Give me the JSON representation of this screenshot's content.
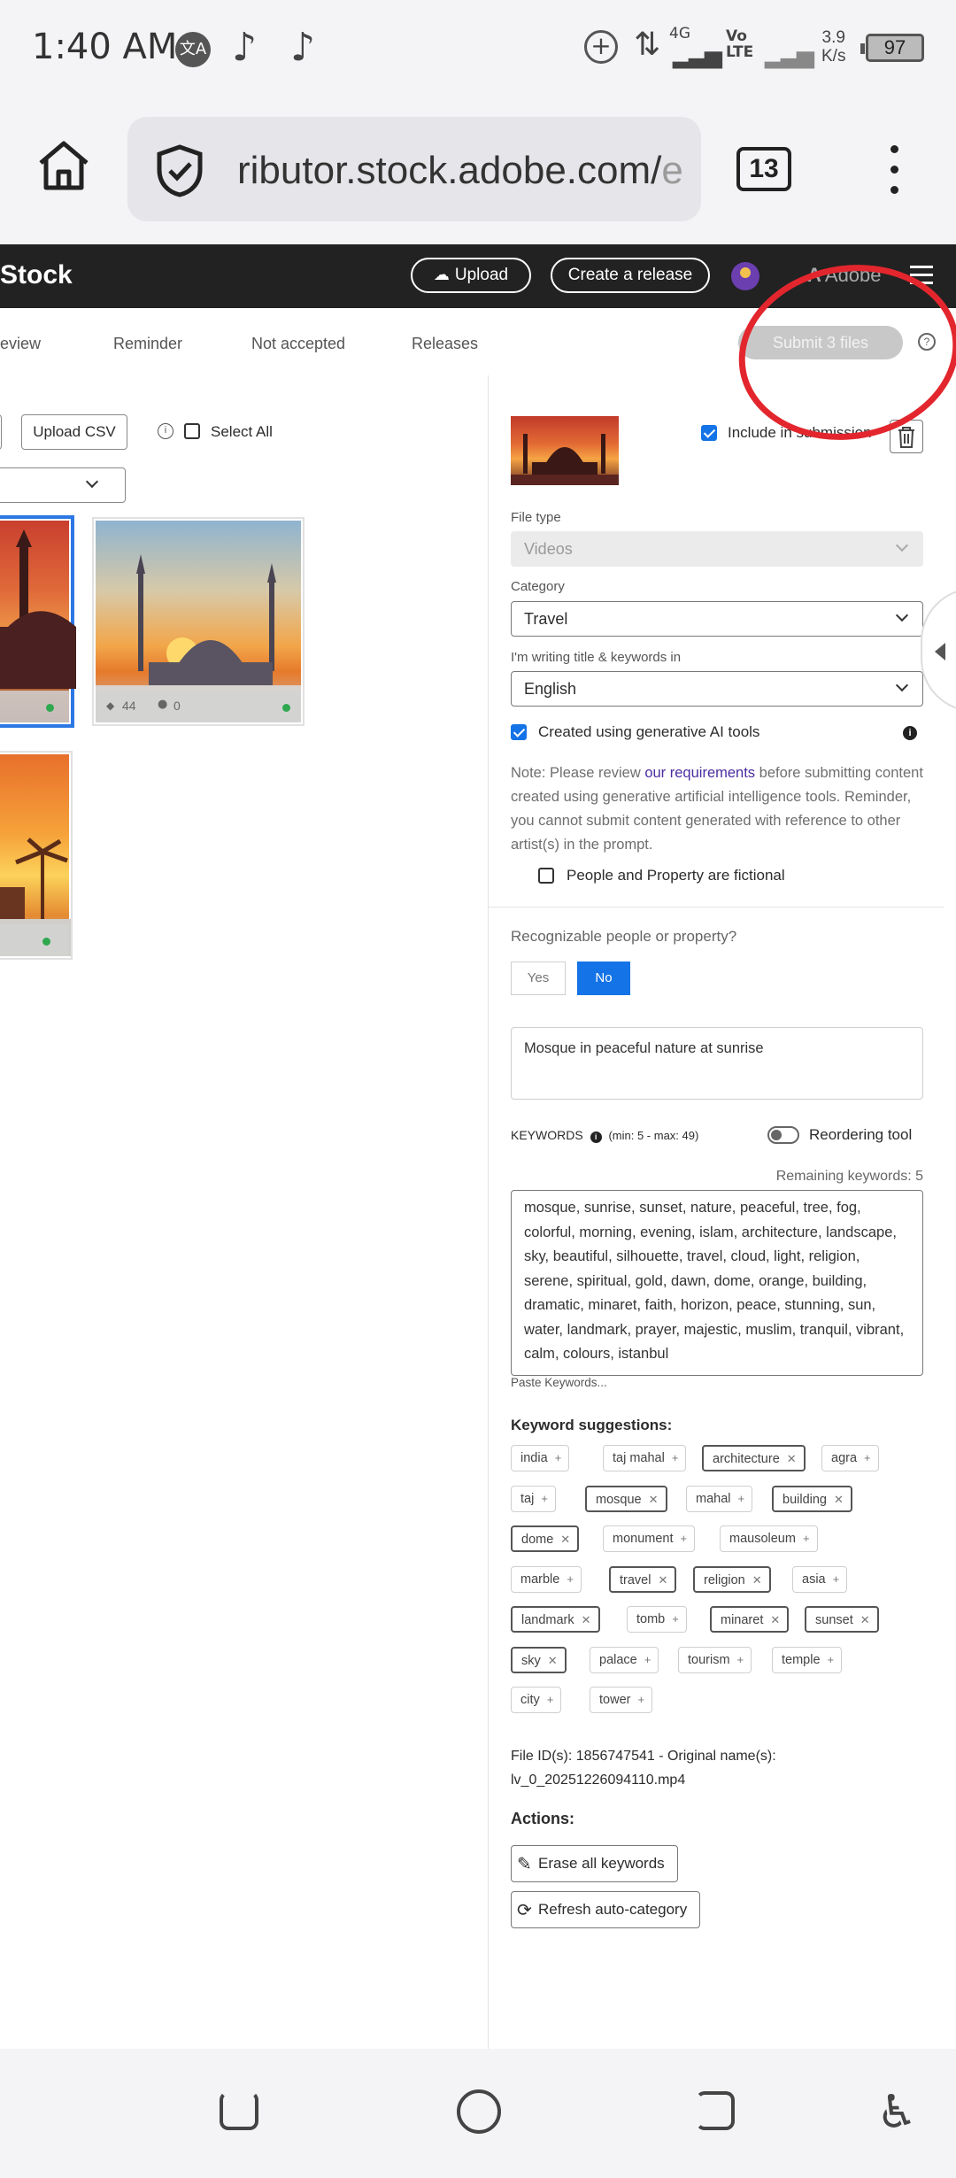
{
  "status_bar": {
    "time": "1:40 AM",
    "net_type": "4G",
    "volte": "Vo LTE",
    "speed_value": "3.9",
    "speed_unit": "K/s",
    "battery": "97",
    "icons": [
      "translate-icon",
      "tiktok-icon",
      "tiktok-icon",
      "data-saver-icon",
      "data-arrows-icon",
      "signal-icon",
      "signal-icon"
    ]
  },
  "browser": {
    "url_main": "ributor.stock.adobe.com/",
    "url_fade": "e",
    "tab_count": "13"
  },
  "header": {
    "brand": "Stock",
    "upload_label": "Upload",
    "create_release_label": "Create a release",
    "adobe_label": "Adobe"
  },
  "tabs": {
    "items": [
      "eview",
      "Reminder",
      "Not accepted",
      "Releases"
    ],
    "submit_label": "Submit 3 files",
    "help_glyph": "?"
  },
  "left": {
    "upload_csv_label": "Upload CSV",
    "select_all_label": "Select All",
    "info_glyph": "i",
    "thumbs": [
      {
        "keywords": "",
        "people": ""
      },
      {
        "keywords": "44",
        "people": "0"
      },
      {
        "keywords": "",
        "people": ""
      }
    ]
  },
  "file": {
    "include_label": "Include in submission",
    "include_checked": true,
    "file_type_label": "File type",
    "file_type_value": "Videos",
    "category_label": "Category",
    "category_value": "Travel",
    "language_label": "I'm writing title & keywords in",
    "language_value": "English",
    "genai_label": "Created using generative AI tools",
    "genai_checked": true,
    "note_before": "Note: Please review ",
    "note_link": "our requirements",
    "note_after": " before submitting content created using generative artificial intelligence tools. Reminder, you cannot submit content generated with reference to other artist(s) in the prompt.",
    "fictional_label": "People and Property are fictional",
    "recognizable_label": "Recognizable people or property?",
    "yes_label": "Yes",
    "no_label": "No",
    "title_value": "Mosque in peaceful nature at sunrise",
    "keywords_label": "KEYWORDS",
    "keywords_range": "(min: 5 - max: 49)",
    "reorder_label": "Reordering tool",
    "remaining_label": "Remaining keywords: 5",
    "keywords_value": "mosque, sunrise, sunset, nature, peaceful, tree, fog, colorful, morning, evening, islam, architecture, landscape, sky, beautiful, silhouette, travel, cloud, light, religion, serene, spiritual, gold, dawn, dome, orange, building, dramatic, minaret, faith, horizon, peace, stunning, sun, water, landmark, prayer, majestic, muslim, tranquil, vibrant, calm, colours, istanbul",
    "paste_label": "Paste Keywords...",
    "suggestions_label": "Keyword suggestions:",
    "suggestions": [
      {
        "label": "india",
        "selected": false
      },
      {
        "label": "taj mahal",
        "selected": false
      },
      {
        "label": "architecture",
        "selected": true
      },
      {
        "label": "agra",
        "selected": false
      },
      {
        "label": "taj",
        "selected": false
      },
      {
        "label": "mosque",
        "selected": true
      },
      {
        "label": "mahal",
        "selected": false
      },
      {
        "label": "building",
        "selected": true
      },
      {
        "label": "dome",
        "selected": true
      },
      {
        "label": "monument",
        "selected": false
      },
      {
        "label": "mausoleum",
        "selected": false
      },
      {
        "label": "marble",
        "selected": false
      },
      {
        "label": "travel",
        "selected": true
      },
      {
        "label": "religion",
        "selected": true
      },
      {
        "label": "asia",
        "selected": false
      },
      {
        "label": "landmark",
        "selected": true
      },
      {
        "label": "tomb",
        "selected": false
      },
      {
        "label": "minaret",
        "selected": true
      },
      {
        "label": "sunset",
        "selected": true
      },
      {
        "label": "sky",
        "selected": true
      },
      {
        "label": "palace",
        "selected": false
      },
      {
        "label": "tourism",
        "selected": false
      },
      {
        "label": "temple",
        "selected": false
      },
      {
        "label": "city",
        "selected": false
      },
      {
        "label": "tower",
        "selected": false
      }
    ],
    "file_id_line1": "File ID(s): 1856747541 - Original name(s):",
    "file_id_line2": "lv_0_20251226094110.mp4",
    "actions_label": "Actions:",
    "erase_label": "Erase all keywords",
    "refresh_label": "Refresh auto-category"
  },
  "colors": {
    "accent_blue": "#1473e6",
    "link_purple": "#4b2ca0",
    "annotation_red": "#e3262d",
    "header_dark": "#222222"
  }
}
